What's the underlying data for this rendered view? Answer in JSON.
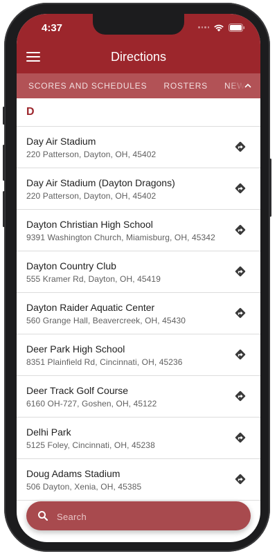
{
  "status": {
    "time": "4:37"
  },
  "header": {
    "title": "Directions"
  },
  "tabs": [
    {
      "label": "SCORES AND SCHEDULES"
    },
    {
      "label": "ROSTERS"
    },
    {
      "label": "NEWS"
    }
  ],
  "section": {
    "letter": "D"
  },
  "locations": [
    {
      "name": "Day Air Stadium",
      "address": "220 Patterson, Dayton, OH, 45402"
    },
    {
      "name": "Day Air Stadium (Dayton Dragons)",
      "address": "220 Patterson, Dayton, OH, 45402"
    },
    {
      "name": "Dayton Christian High School",
      "address": "9391 Washington Church, Miamisburg, OH, 45342"
    },
    {
      "name": "Dayton Country Club",
      "address": "555 Kramer Rd, Dayton, OH, 45419"
    },
    {
      "name": "Dayton Raider Aquatic Center",
      "address": "560 Grange Hall, Beavercreek, OH, 45430"
    },
    {
      "name": "Deer Park High School",
      "address": "8351 Plainfield Rd, Cincinnati, OH, 45236"
    },
    {
      "name": "Deer Track Golf Course",
      "address": "6160 OH-727, Goshen, OH, 45122"
    },
    {
      "name": "Delhi Park",
      "address": "5125 Foley, Cincinnati, OH, 45238"
    },
    {
      "name": "Doug Adams Stadium",
      "address": "506 Dayton, Xenia, OH, 45385"
    }
  ],
  "search": {
    "placeholder": "Search"
  },
  "colors": {
    "brand": "#9c262c",
    "tab_bar": "#b25256",
    "search_bar": "#a84a4e"
  }
}
